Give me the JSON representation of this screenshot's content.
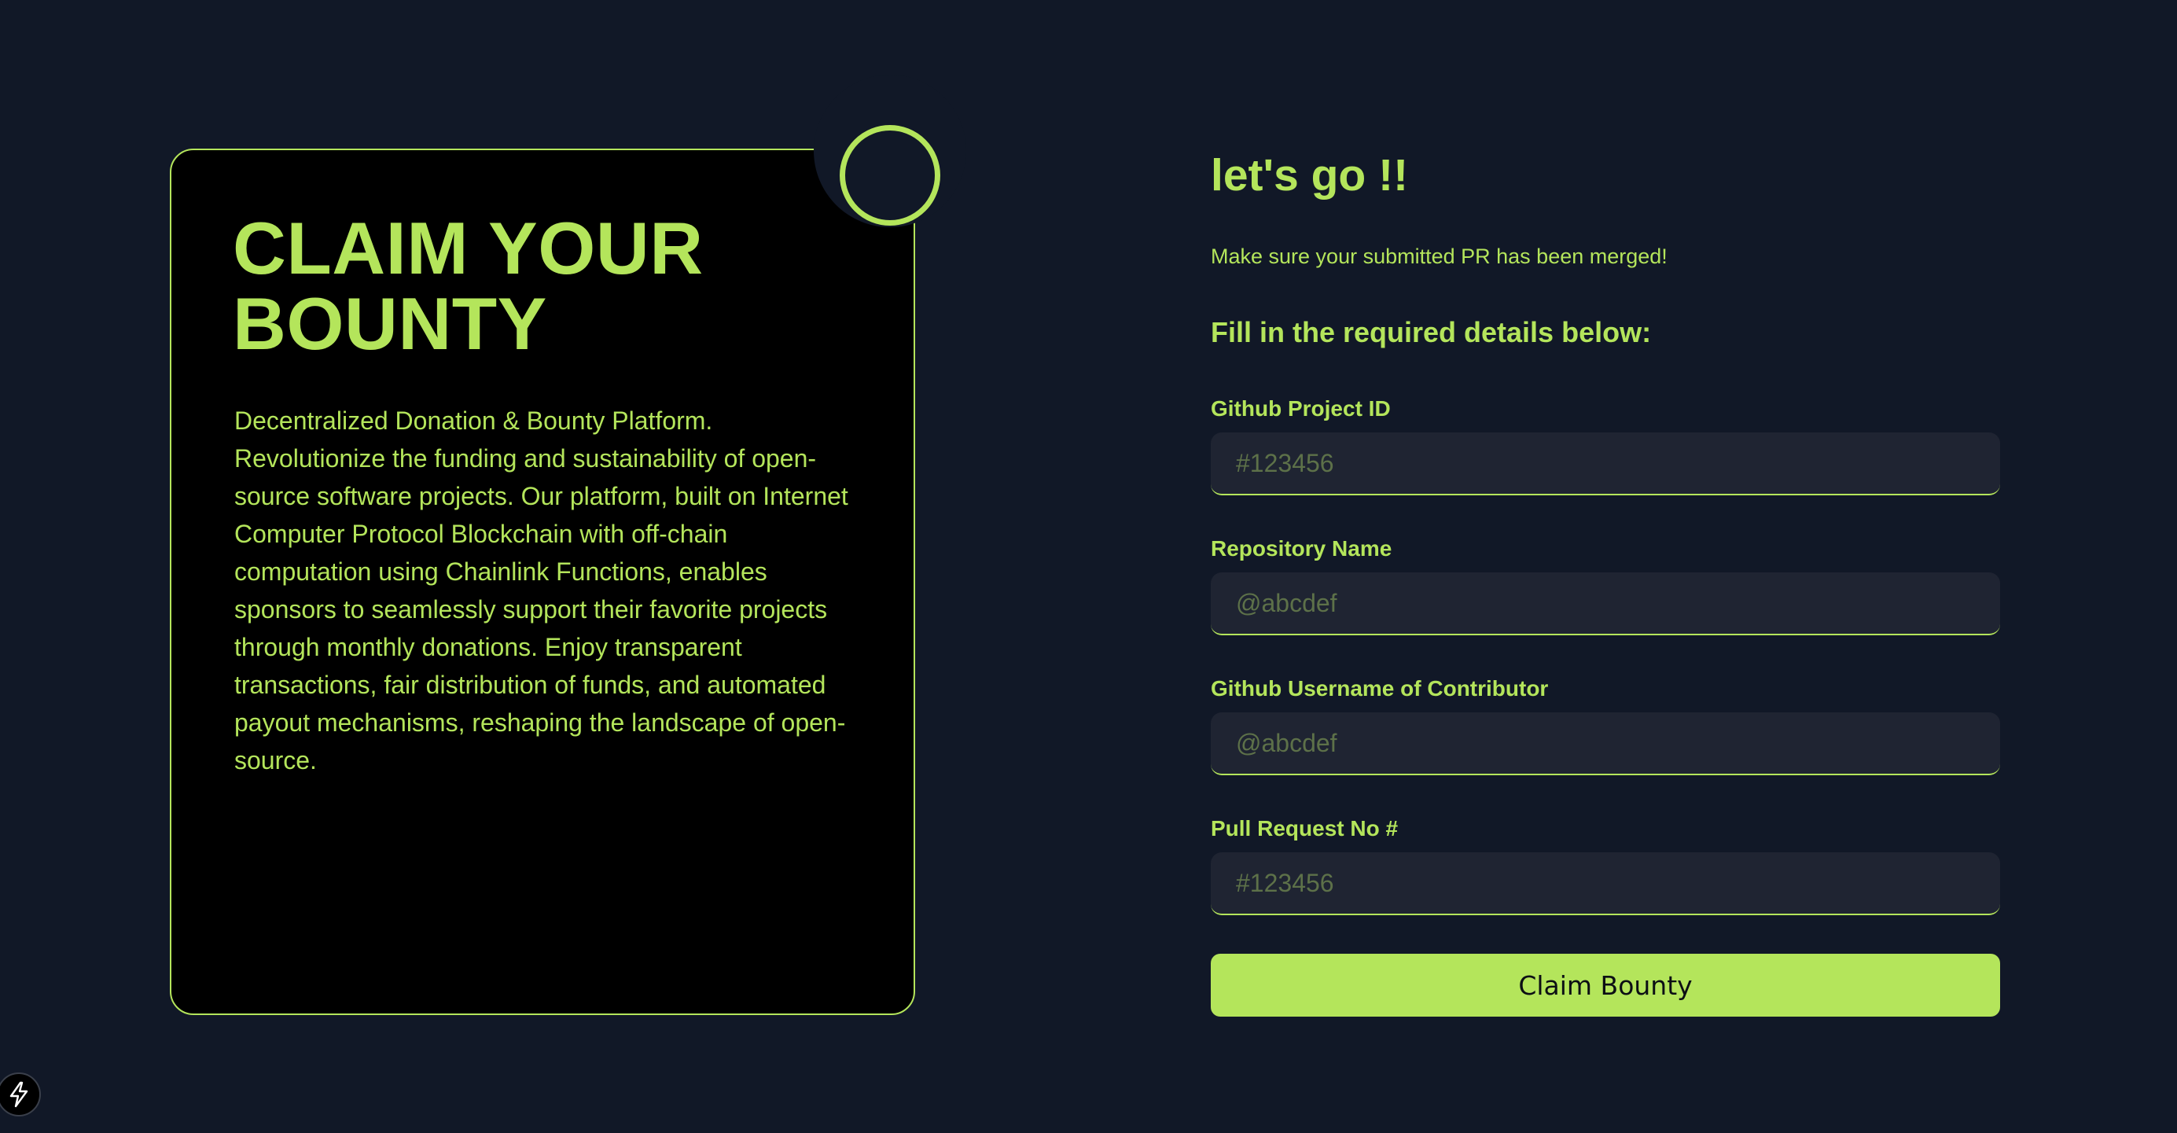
{
  "card": {
    "title_line1": "CLAIM YOUR",
    "title_line2": "BOUNTY",
    "description": "Decentralized Donation & Bounty Platform. Revolutionize the funding and sustainability of open-source software projects. Our platform, built on Internet Computer Protocol Blockchain with off-chain computation using Chainlink Functions, enables sponsors to seamlessly support their favorite projects through monthly donations. Enjoy transparent transactions, fair distribution of funds, and automated payout mechanisms, reshaping the landscape of open-source."
  },
  "form": {
    "heading": "let's go !!",
    "note": "Make sure your submitted PR has been merged!",
    "subheading": "Fill in the required details below:",
    "fields": [
      {
        "label": "Github Project ID",
        "value": "",
        "placeholder": "#123456"
      },
      {
        "label": "Repository Name",
        "value": "",
        "placeholder": "@abcdef"
      },
      {
        "label": "Github Username of Contributor",
        "value": "",
        "placeholder": "@abcdef"
      },
      {
        "label": "Pull Request No #",
        "value": "",
        "placeholder": "#123456"
      }
    ],
    "submit_label": "Claim Bounty"
  },
  "colors": {
    "background": "#111827",
    "accent": "#b4e55b",
    "card_bg": "#000000",
    "input_bg": "#1f2432"
  },
  "icons": {
    "decor": "ring-icon",
    "badge": "lightning-icon"
  }
}
